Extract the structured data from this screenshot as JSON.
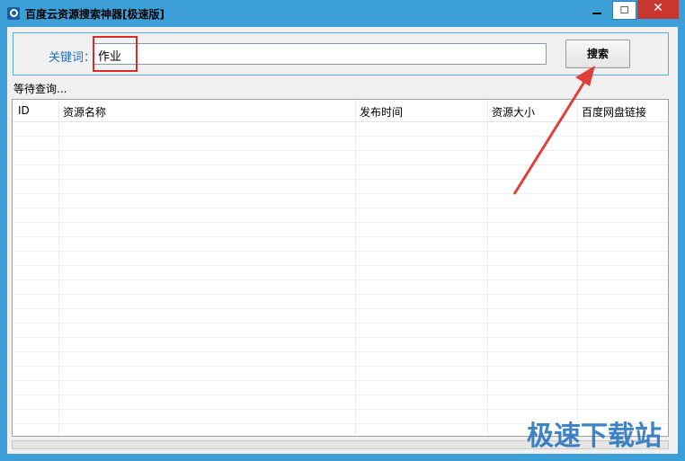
{
  "window": {
    "title": "百度云资源搜索神器[极速版]",
    "min_label": "—",
    "max_label": "☐",
    "close_label": "✕"
  },
  "search": {
    "label": "关键词：",
    "value": "作业",
    "button_label": "搜索"
  },
  "status": "等待查询...",
  "table": {
    "columns": [
      "ID",
      "资源名称",
      "发布时间",
      "资源大小",
      "百度网盘链接"
    ]
  },
  "watermark": "极速下载站",
  "colors": {
    "accent": "#3d9fd8",
    "highlight": "#d92b2b",
    "label": "#1f6fbf"
  }
}
